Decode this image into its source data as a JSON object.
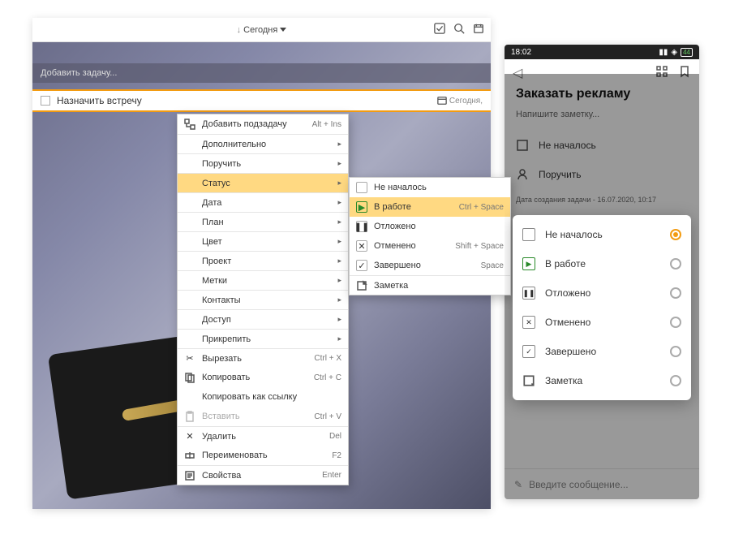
{
  "desktop": {
    "toolbar": {
      "center_label": "Сегодня"
    },
    "add_placeholder": "Добавить задачу...",
    "task": {
      "title": "Назначить встречу",
      "date_label": "Сегодня,"
    }
  },
  "ctx": {
    "add_subtask": "Добавить подзадачу",
    "add_subtask_key": "Alt + Ins",
    "more": "Дополнительно",
    "assign": "Поручить",
    "status": "Статус",
    "date": "Дата",
    "plan": "План",
    "color": "Цвет",
    "project": "Проект",
    "tags": "Метки",
    "contacts": "Контакты",
    "access": "Доступ",
    "attach": "Прикрепить",
    "cut": "Вырезать",
    "cut_key": "Ctrl + X",
    "copy": "Копировать",
    "copy_key": "Ctrl + C",
    "copy_link": "Копировать как ссылку",
    "paste": "Вставить",
    "paste_key": "Ctrl + V",
    "delete": "Удалить",
    "delete_key": "Del",
    "rename": "Переименовать",
    "rename_key": "F2",
    "props": "Свойства",
    "props_key": "Enter"
  },
  "sub": {
    "not_started": "Не началось",
    "in_progress": "В работе",
    "in_progress_key": "Ctrl + Space",
    "postponed": "Отложено",
    "cancelled": "Отменено",
    "cancelled_key": "Shift + Space",
    "done": "Завершено",
    "done_key": "Space",
    "note": "Заметка"
  },
  "mobile": {
    "time": "18:02",
    "battery": "44",
    "title": "Заказать рекламу",
    "note_placeholder": "Напишите заметку...",
    "not_started": "Не началось",
    "assign": "Поручить",
    "created": "Дата создания задачи - 16.07.2020, 10:17",
    "input_placeholder": "Введите сообщение..."
  },
  "mdialog": {
    "not_started": "Не началось",
    "in_progress": "В работе",
    "postponed": "Отложено",
    "cancelled": "Отменено",
    "done": "Завершено",
    "note": "Заметка"
  }
}
